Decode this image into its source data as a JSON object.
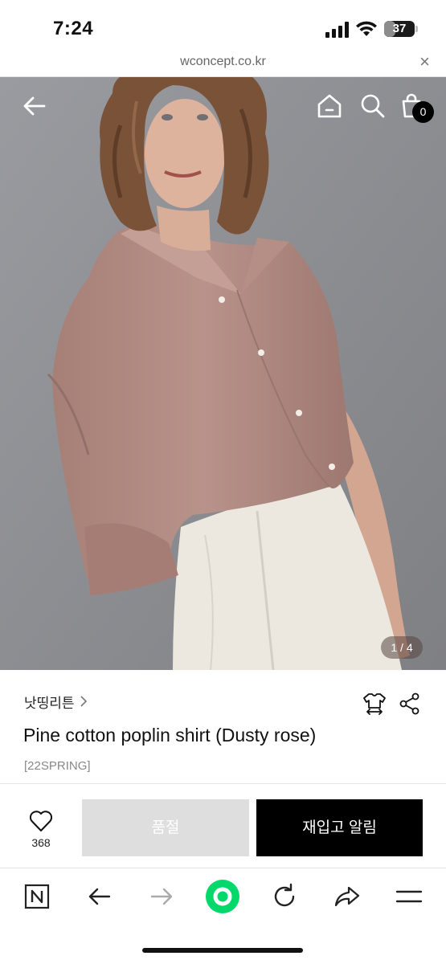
{
  "status": {
    "time": "7:24",
    "battery": "37",
    "battery_level": 0.37
  },
  "browser": {
    "url": "wconcept.co.kr",
    "close_glyph": "×"
  },
  "gallery": {
    "current": 1,
    "total": 4,
    "indicator": "1 / 4",
    "cart_count": "0"
  },
  "product": {
    "brand": "낫띵리튼",
    "title": "Pine cotton poplin shirt (Dusty rose)",
    "season": "[22SPRING]",
    "like_count": "368",
    "soldout_label": "품절",
    "restock_label": "재입고 알림"
  },
  "icons": {
    "back": "back-arrow-icon",
    "home": "home-icon",
    "search": "search-icon",
    "cart": "shopping-bag-icon",
    "size": "size-guide-shirt-icon",
    "share": "share-icon",
    "heart": "heart-icon",
    "naver": "naver-n-icon",
    "forward": "forward-arrow-icon",
    "green": "green-home-icon",
    "reload": "reload-icon",
    "toolbar_share": "share-forward-icon",
    "menu": "menu-icon"
  },
  "colors": {
    "soldout_bg": "#dedede",
    "restock_bg": "#000000",
    "green_button": "#03d96b",
    "shirt": "#b0897f",
    "backdrop": "#8d8e92"
  }
}
